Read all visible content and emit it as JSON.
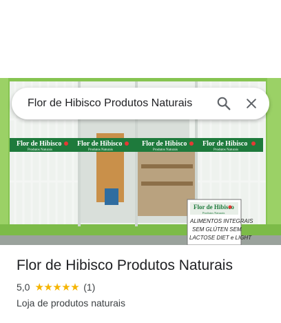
{
  "search": {
    "query": "Flor de Hibisco Produtos Naturais",
    "search_icon": "search-icon",
    "close_icon": "close-icon"
  },
  "photo": {
    "signs": [
      {
        "name": "Flor de Hibisco",
        "subtitle": "Produtos Naturais"
      },
      {
        "name": "Flor de Hibisco",
        "subtitle": "Produtos Naturais"
      },
      {
        "name": "Flor de Hibisco",
        "subtitle": "Produtos Naturais"
      },
      {
        "name": "Flor de Hibisco",
        "subtitle": "Produtos Naturais"
      }
    ],
    "board": {
      "name": "Flor de Hibisco",
      "subtitle": "Produtos Naturais",
      "lines": [
        "ALIMENTOS INTEGRAIS",
        "SEM GLÚTEN SEM",
        "LACTOSE DIET e LIGHT"
      ]
    }
  },
  "place": {
    "name": "Flor de Hibisco Produtos Naturais",
    "rating": "5,0",
    "stars": "★★★★★",
    "rating_value": 5,
    "review_count": "(1)",
    "category": "Loja de produtos naturais"
  },
  "colors": {
    "accent_star": "#f5b400",
    "wall_green": "#7fbf4a",
    "sign_green": "#1e7a3c"
  }
}
